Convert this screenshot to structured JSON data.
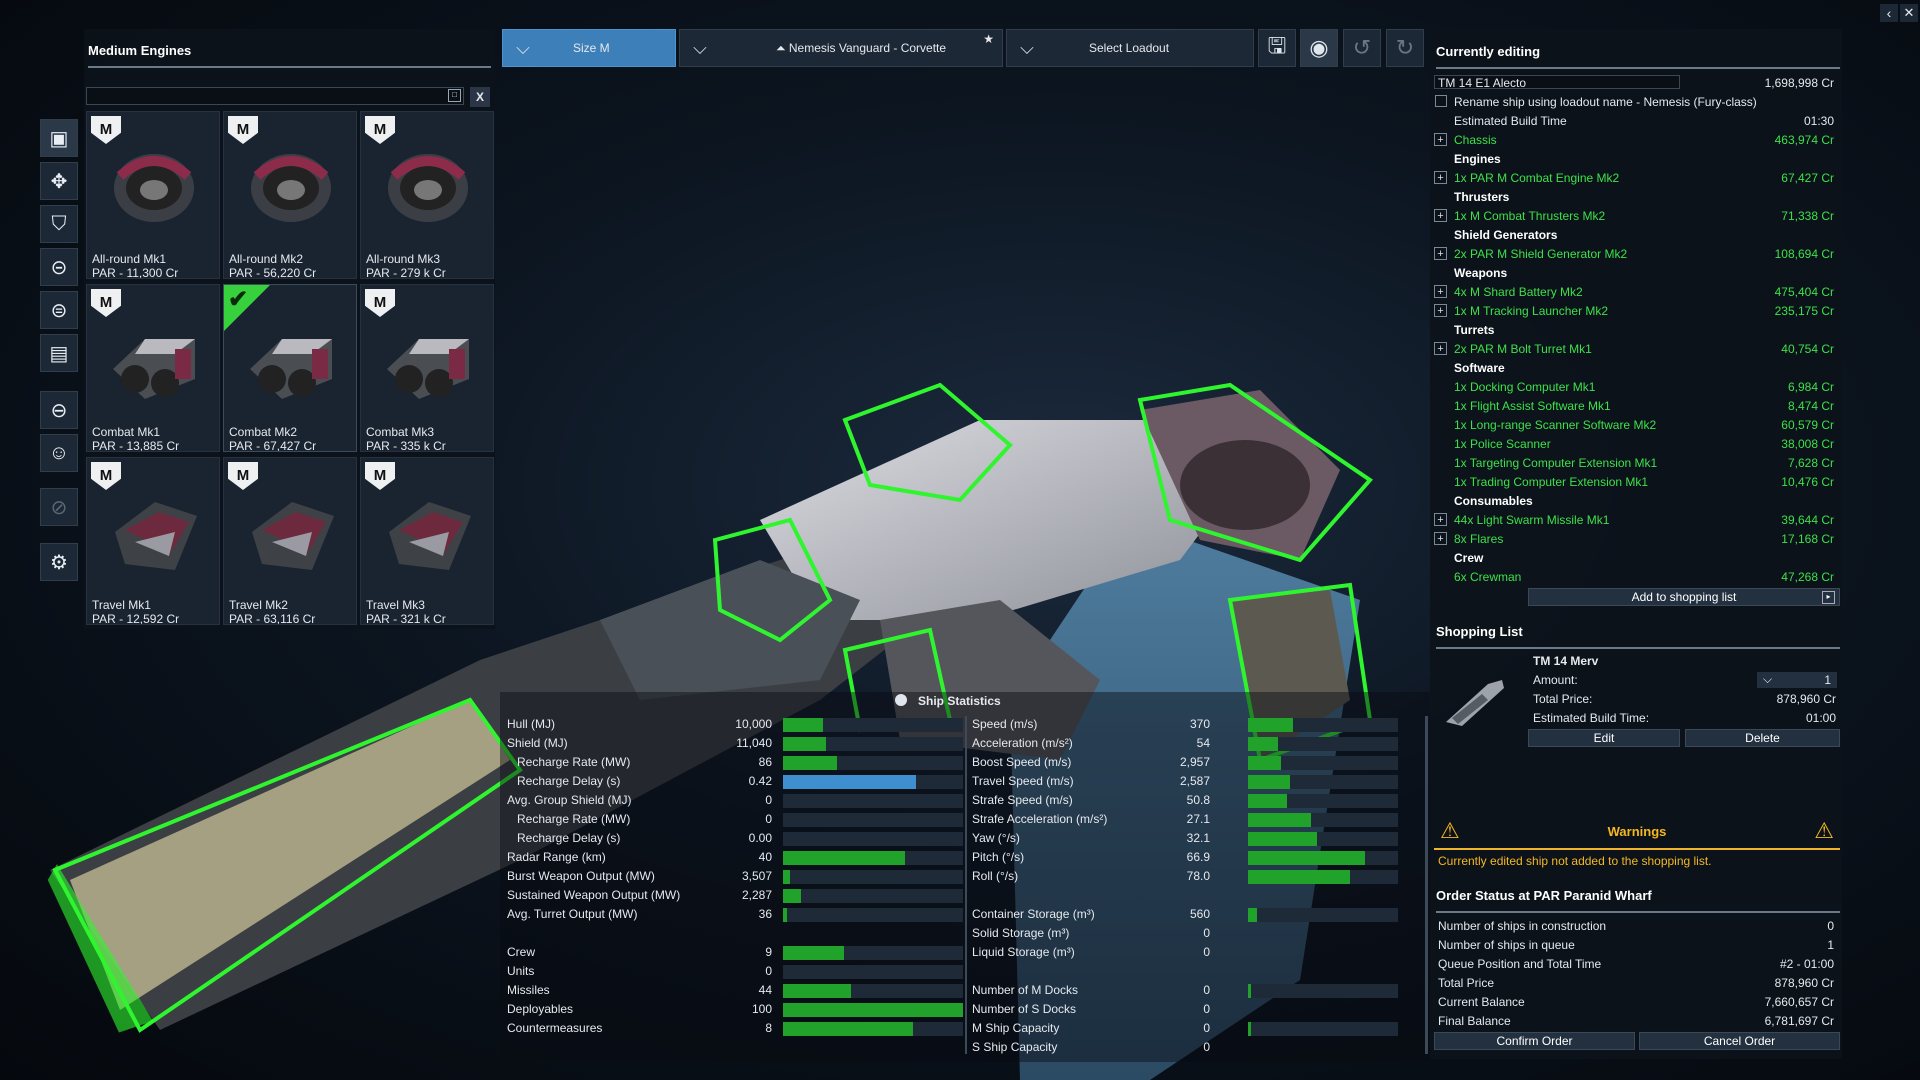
{
  "left": {
    "title": "Medium Engines",
    "search_placeholder": "",
    "clear_label": "X",
    "engines": [
      {
        "name": "All-round Mk1",
        "price": "PAR - 11,300 Cr",
        "selected": false
      },
      {
        "name": "All-round Mk2",
        "price": "PAR - 56,220 Cr",
        "selected": false
      },
      {
        "name": "All-round Mk3",
        "price": "PAR - 279 k Cr",
        "selected": false
      },
      {
        "name": "Combat Mk1",
        "price": "PAR - 13,885 Cr",
        "selected": false
      },
      {
        "name": "Combat Mk2",
        "price": "PAR - 67,427 Cr",
        "selected": true
      },
      {
        "name": "Combat Mk3",
        "price": "PAR - 335 k Cr",
        "selected": false
      },
      {
        "name": "Travel Mk1",
        "price": "PAR - 12,592 Cr",
        "selected": false
      },
      {
        "name": "Travel Mk2",
        "price": "PAR - 63,116 Cr",
        "selected": false
      },
      {
        "name": "Travel Mk3",
        "price": "PAR - 321 k Cr",
        "selected": false
      }
    ],
    "size_badge": "M",
    "sidebar_icons": [
      "chassis-icon",
      "engine-icon",
      "shield-icon",
      "weapon-icon",
      "turret-icon",
      "software-icon",
      "consumable-icon",
      "crew-icon",
      "disabled-icon",
      "settings-icon"
    ]
  },
  "topbar": {
    "size": "Size M",
    "ship": "Nemesis Vanguard - Corvette",
    "loadout": "Select Loadout"
  },
  "editing": {
    "title": "Currently editing",
    "ship_name": "TM 14 E1 Alecto",
    "ship_price": "1,698,998 Cr",
    "rename_label": "Rename ship using loadout name - Nemesis (Fury-class)",
    "build_time_label": "Estimated Build Time",
    "build_time": "01:30",
    "chassis": {
      "label": "Chassis",
      "price": "463,974 Cr"
    },
    "sections": [
      {
        "title": "Engines",
        "items": [
          {
            "label": "1x PAR M Combat Engine Mk2",
            "price": "67,427 Cr",
            "plus": true
          }
        ]
      },
      {
        "title": "Thrusters",
        "items": [
          {
            "label": "1x M Combat Thrusters Mk2",
            "price": "71,338 Cr",
            "plus": true
          }
        ]
      },
      {
        "title": "Shield Generators",
        "items": [
          {
            "label": "2x PAR M Shield Generator Mk2",
            "price": "108,694 Cr",
            "plus": true
          }
        ]
      },
      {
        "title": "Weapons",
        "items": [
          {
            "label": "4x M Shard Battery Mk2",
            "price": "475,404 Cr",
            "plus": true
          },
          {
            "label": "1x M Tracking Launcher Mk2",
            "price": "235,175 Cr",
            "plus": true
          }
        ]
      },
      {
        "title": "Turrets",
        "items": [
          {
            "label": "2x PAR M Bolt Turret Mk1",
            "price": "40,754 Cr",
            "plus": true
          }
        ]
      },
      {
        "title": "Software",
        "items": [
          {
            "label": "1x Docking Computer Mk1",
            "price": "6,984 Cr",
            "plus": false
          },
          {
            "label": "1x Flight Assist Software Mk1",
            "price": "8,474 Cr",
            "plus": false
          },
          {
            "label": "1x Long-range Scanner Software Mk2",
            "price": "60,579 Cr",
            "plus": false
          },
          {
            "label": "1x Police Scanner",
            "price": "38,008 Cr",
            "plus": false
          },
          {
            "label": "1x Targeting Computer Extension Mk1",
            "price": "7,628 Cr",
            "plus": false
          },
          {
            "label": "1x Trading Computer Extension Mk1",
            "price": "10,476 Cr",
            "plus": false
          }
        ]
      },
      {
        "title": "Consumables",
        "items": [
          {
            "label": "44x Light Swarm Missile Mk1",
            "price": "39,644 Cr",
            "plus": true
          },
          {
            "label": "8x Flares",
            "price": "17,168 Cr",
            "plus": true
          }
        ]
      },
      {
        "title": "Crew",
        "items": [
          {
            "label": "6x Crewman",
            "price": "47,268 Cr",
            "plus": false
          }
        ]
      }
    ],
    "add_to_list": "Add to shopping list"
  },
  "shopping": {
    "title": "Shopping List",
    "item_name": "TM 14 Merv",
    "amount_label": "Amount:",
    "amount": "1",
    "total_label": "Total Price:",
    "total": "878,960 Cr",
    "build_label": "Estimated Build Time:",
    "build": "01:00",
    "edit": "Edit",
    "delete": "Delete"
  },
  "warnings": {
    "title": "Warnings",
    "text": "Currently edited ship not added to the shopping list."
  },
  "order": {
    "title": "Order Status at PAR Paranid Wharf",
    "rows": [
      {
        "label": "Number of ships in construction",
        "value": "0"
      },
      {
        "label": "Number of ships in queue",
        "value": "1"
      },
      {
        "label": "Queue Position and Total Time",
        "value": "#2 - 01:00"
      },
      {
        "label": "Total Price",
        "value": "878,960 Cr"
      },
      {
        "label": "Current Balance",
        "value": "7,660,657 Cr"
      },
      {
        "label": "Final Balance",
        "value": "6,781,697 Cr"
      }
    ],
    "confirm": "Confirm Order",
    "cancel": "Cancel Order"
  },
  "stats": {
    "title": "Ship Statistics",
    "left": [
      {
        "label": "Hull (MJ)",
        "value": "10,000",
        "fill": 0.22,
        "indent": false,
        "color": "green"
      },
      {
        "label": "Shield (MJ)",
        "value": "11,040",
        "fill": 0.24,
        "indent": false,
        "color": "green"
      },
      {
        "label": "Recharge Rate (MW)",
        "value": "86",
        "fill": 0.3,
        "indent": true,
        "color": "green"
      },
      {
        "label": "Recharge Delay (s)",
        "value": "0.42",
        "fill": 0.74,
        "indent": true,
        "color": "blue"
      },
      {
        "label": "Avg. Group Shield (MJ)",
        "value": "0",
        "fill": 0.0,
        "indent": false,
        "color": "green"
      },
      {
        "label": "Recharge Rate (MW)",
        "value": "0",
        "fill": 0.0,
        "indent": true,
        "color": "green"
      },
      {
        "label": "Recharge Delay (s)",
        "value": "0.00",
        "fill": 0.0,
        "indent": true,
        "color": "green"
      },
      {
        "label": "Radar Range (km)",
        "value": "40",
        "fill": 0.68,
        "indent": false,
        "color": "green"
      },
      {
        "label": "Burst Weapon Output (MW)",
        "value": "3,507",
        "fill": 0.04,
        "indent": false,
        "color": "green"
      },
      {
        "label": "Sustained Weapon Output (MW)",
        "value": "2,287",
        "fill": 0.1,
        "indent": false,
        "color": "green"
      },
      {
        "label": "Avg. Turret Output (MW)",
        "value": "36",
        "fill": 0.02,
        "indent": false,
        "color": "green"
      },
      {
        "label": "",
        "value": "",
        "fill": -1,
        "indent": false,
        "color": "green"
      },
      {
        "label": "Crew",
        "value": "9",
        "fill": 0.34,
        "indent": false,
        "color": "green"
      },
      {
        "label": "Units",
        "value": "0",
        "fill": 0.0,
        "indent": false,
        "color": "green"
      },
      {
        "label": "Missiles",
        "value": "44",
        "fill": 0.38,
        "indent": false,
        "color": "green"
      },
      {
        "label": "Deployables",
        "value": "100",
        "fill": 1.0,
        "indent": false,
        "color": "green"
      },
      {
        "label": "Countermeasures",
        "value": "8",
        "fill": 0.72,
        "indent": false,
        "color": "green"
      }
    ],
    "right": [
      {
        "label": "Speed (m/s)",
        "value": "370",
        "fill": 0.3
      },
      {
        "label": "Acceleration (m/s²)",
        "value": "54",
        "fill": 0.2
      },
      {
        "label": "Boost Speed (m/s)",
        "value": "2,957",
        "fill": 0.22
      },
      {
        "label": "Travel Speed (m/s)",
        "value": "2,587",
        "fill": 0.28
      },
      {
        "label": "Strafe Speed (m/s)",
        "value": "50.8",
        "fill": 0.26
      },
      {
        "label": "Strafe Acceleration (m/s²)",
        "value": "27.1",
        "fill": 0.42
      },
      {
        "label": "Yaw (°/s)",
        "value": "32.1",
        "fill": 0.46
      },
      {
        "label": "Pitch (°/s)",
        "value": "66.9",
        "fill": 0.78
      },
      {
        "label": "Roll (°/s)",
        "value": "78.0",
        "fill": 0.68
      },
      {
        "label": "",
        "value": "",
        "fill": -1
      },
      {
        "label": "Container Storage (m³)",
        "value": "560",
        "fill": 0.06
      },
      {
        "label": "Solid Storage (m³)",
        "value": "0",
        "fill": -1
      },
      {
        "label": "Liquid Storage (m³)",
        "value": "0",
        "fill": -1
      },
      {
        "label": "",
        "value": "",
        "fill": -1
      },
      {
        "label": "Number of M Docks",
        "value": "0",
        "fill": 0.02
      },
      {
        "label": "Number of S Docks",
        "value": "0",
        "fill": -1
      },
      {
        "label": "M Ship Capacity",
        "value": "0",
        "fill": 0.02
      },
      {
        "label": "S Ship Capacity",
        "value": "0",
        "fill": -1
      }
    ]
  }
}
